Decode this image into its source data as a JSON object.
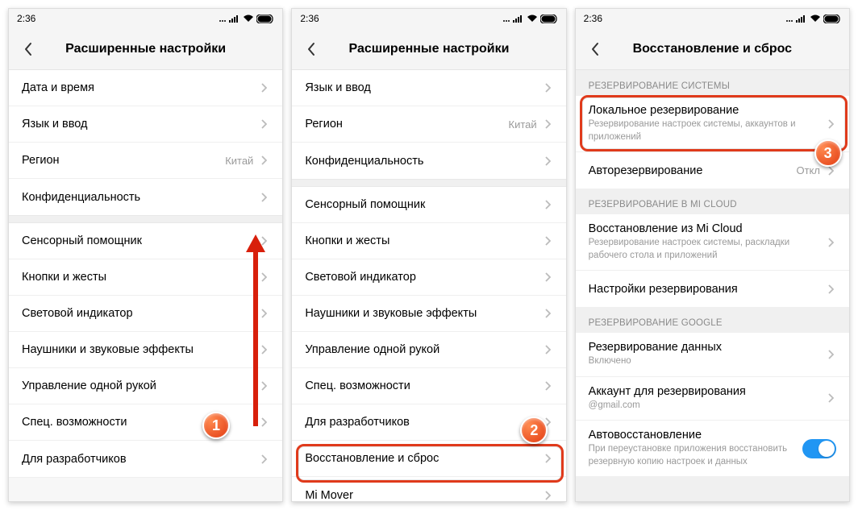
{
  "statusbar": {
    "time": "2:36"
  },
  "panel1": {
    "title": "Расширенные настройки",
    "rows": [
      {
        "label": "Дата и время"
      },
      {
        "label": "Язык и ввод"
      },
      {
        "label": "Регион",
        "value": "Китай"
      },
      {
        "label": "Конфиденциальность"
      }
    ],
    "rows2": [
      {
        "label": "Сенсорный помощник"
      },
      {
        "label": "Кнопки и жесты"
      },
      {
        "label": "Световой индикатор"
      },
      {
        "label": "Наушники и звуковые эффекты"
      },
      {
        "label": "Управление одной рукой"
      },
      {
        "label": "Спец. возможности"
      },
      {
        "label": "Для разработчиков"
      }
    ],
    "badge": "1"
  },
  "panel2": {
    "title": "Расширенные настройки",
    "rows": [
      {
        "label": "Язык и ввод"
      },
      {
        "label": "Регион",
        "value": "Китай"
      },
      {
        "label": "Конфиденциальность"
      }
    ],
    "rows2": [
      {
        "label": "Сенсорный помощник"
      },
      {
        "label": "Кнопки и жесты"
      },
      {
        "label": "Световой индикатор"
      },
      {
        "label": "Наушники и звуковые эффекты"
      },
      {
        "label": "Управление одной рукой"
      },
      {
        "label": "Спец. возможности"
      },
      {
        "label": "Для разработчиков"
      },
      {
        "label": "Восстановление и сброс"
      },
      {
        "label": "Mi Mover"
      }
    ],
    "badge": "2"
  },
  "panel3": {
    "title": "Восстановление и сброс",
    "section1": "РЕЗЕРВИРОВАНИЕ СИСТЕМЫ",
    "row_local": {
      "label": "Локальное резервирование",
      "sub": "Резервирование настроек системы, аккаунтов и приложений"
    },
    "row_auto": {
      "label": "Авторезервирование",
      "value": "Откл"
    },
    "section2": "РЕЗЕРВИРОВАНИЕ В MI CLOUD",
    "row_micloud": {
      "label": "Восстановление из Mi Cloud",
      "sub": "Резервирование настроек системы, раскладки рабочего стола и приложений"
    },
    "row_misettings": {
      "label": "Настройки резервирования"
    },
    "section3": "РЕЗЕРВИРОВАНИЕ GOOGLE",
    "row_gdata": {
      "label": "Резервирование данных",
      "sub": "Включено"
    },
    "row_gacct": {
      "label": "Аккаунт для резервирования",
      "sub": "@gmail.com"
    },
    "row_grestore": {
      "label": "Автовосстановление",
      "sub": "При переустановке приложения восстановить резервную копию настроек и данных"
    },
    "badge": "3"
  }
}
